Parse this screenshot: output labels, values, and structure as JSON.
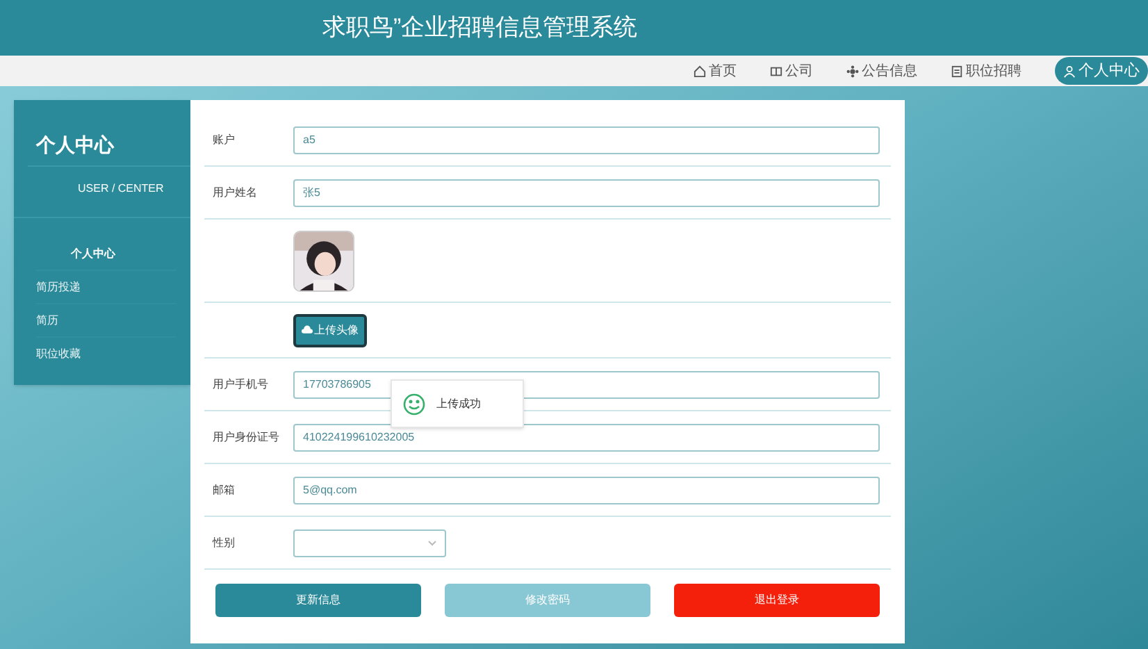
{
  "header": {
    "title": "求职鸟”企业招聘信息管理系统"
  },
  "nav": [
    {
      "kind": "home",
      "label": "首页",
      "selected": false
    },
    {
      "kind": "company",
      "label": "公司",
      "selected": false
    },
    {
      "kind": "notice",
      "label": "公告信息",
      "selected": false
    },
    {
      "kind": "job",
      "label": "职位招聘",
      "selected": false
    },
    {
      "kind": "user",
      "label": "个人中心",
      "selected": true
    }
  ],
  "sidebar": {
    "title": "个人中心",
    "subtitle": "USER / CENTER",
    "items": [
      {
        "label": "个人中心",
        "selected": true
      },
      {
        "label": "简历投递",
        "selected": false
      },
      {
        "label": "简历",
        "selected": false
      },
      {
        "label": "职位收藏",
        "selected": false
      }
    ]
  },
  "form": {
    "rows": [
      {
        "kind": "text",
        "label": "账户",
        "value": "a5"
      },
      {
        "kind": "text",
        "label": "用户姓名",
        "value": "张5"
      },
      {
        "kind": "avatar"
      },
      {
        "kind": "upload",
        "button": "上传头像"
      },
      {
        "kind": "text",
        "label": "用户手机号",
        "value": "17703786905"
      },
      {
        "kind": "text",
        "label": "用户身份证号",
        "value": "410224199610232005"
      },
      {
        "kind": "text",
        "label": "邮箱",
        "value": "5@qq.com"
      },
      {
        "kind": "select",
        "label": "性别"
      }
    ],
    "buttons": [
      {
        "kind": "primary",
        "label": "更新信息"
      },
      {
        "kind": "light",
        "label": "修改密码"
      },
      {
        "kind": "danger",
        "label": "退出登录"
      }
    ]
  },
  "toast": {
    "message": "上传成功"
  }
}
